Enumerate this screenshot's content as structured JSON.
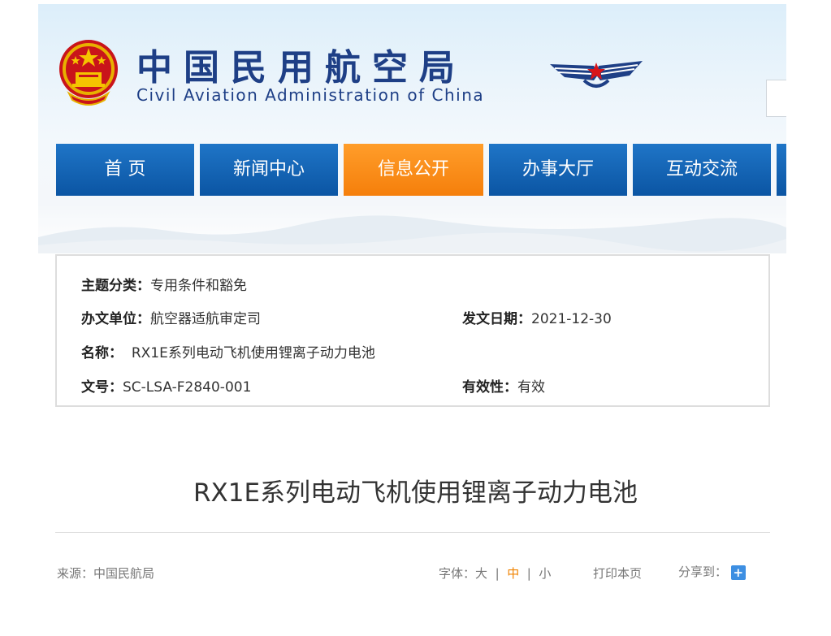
{
  "header": {
    "title_cn": "中国民用航空局",
    "title_en": "Civil Aviation Administration of China"
  },
  "nav": [
    {
      "label": "首 页"
    },
    {
      "label": "新闻中心"
    },
    {
      "label": "信息公开",
      "active": true
    },
    {
      "label": "办事大厅"
    },
    {
      "label": "互动交流"
    }
  ],
  "info": {
    "subject_label": "主题分类：",
    "subject_value": "专用条件和豁免",
    "dept_label": "办文单位：",
    "dept_value": "航空器适航审定司",
    "date_label": "发文日期：",
    "date_value": "2021-12-30",
    "name_label": "名称：",
    "name_value": "RX1E系列电动飞机使用锂离子动力电池",
    "docno_label": "文号：",
    "docno_value": "SC-LSA-F2840-001",
    "validity_label": "有效性：",
    "validity_value": "有效"
  },
  "article": {
    "title": "RX1E系列电动飞机使用锂离子动力电池"
  },
  "meta": {
    "source_label": "来源：",
    "source_value": "中国民航局",
    "font_label": "字体：",
    "font_large": "大",
    "sep": "|",
    "font_medium": "中",
    "font_small": "小",
    "print_label": "打印本页",
    "share_label": "分享到：",
    "share_icon": "+"
  },
  "colors": {
    "nav_blue": "#0b55a3",
    "nav_active_orange": "#f57f0b",
    "logo_blue": "#1e3f86",
    "share_blue": "#3d8fe2"
  }
}
